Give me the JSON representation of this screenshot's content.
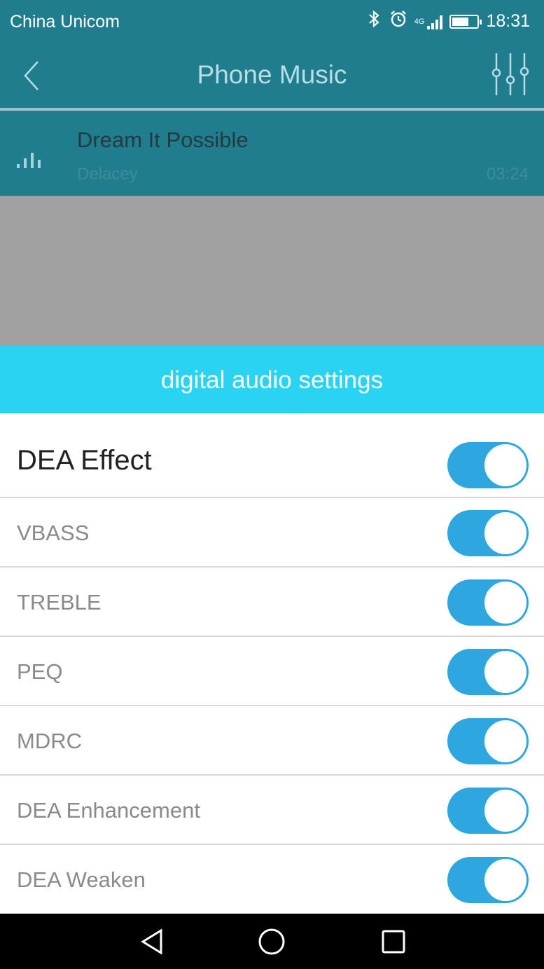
{
  "status_bar": {
    "carrier": "China Unicom",
    "network": "4G",
    "time": "18:31",
    "icons": [
      "bluetooth-icon",
      "alarm-icon",
      "signal-icon",
      "battery-icon"
    ]
  },
  "header": {
    "title": "Phone Music",
    "back_icon": "chevron-left-icon",
    "equalizer_icon": "equalizer-sliders-icon"
  },
  "now_playing": {
    "title": "Dream It Possible",
    "artist": "Delacey",
    "duration": "03:24"
  },
  "settings_sheet": {
    "title": "digital audio settings",
    "items": [
      {
        "label": "DEA Effect",
        "enabled": true
      },
      {
        "label": "VBASS",
        "enabled": true
      },
      {
        "label": "TREBLE",
        "enabled": true
      },
      {
        "label": "PEQ",
        "enabled": true
      },
      {
        "label": "MDRC",
        "enabled": true
      },
      {
        "label": "DEA Enhancement",
        "enabled": true
      },
      {
        "label": "DEA Weaken",
        "enabled": true
      }
    ]
  },
  "nav_bar": {
    "buttons": [
      "back-triangle-icon",
      "home-circle-icon",
      "recents-square-icon"
    ]
  },
  "colors": {
    "header_bg": "#1f7d8e",
    "sheet_header_bg": "#2bd3f3",
    "toggle_on": "#2ea6e0",
    "dim_overlay": "#a0a0a0"
  }
}
